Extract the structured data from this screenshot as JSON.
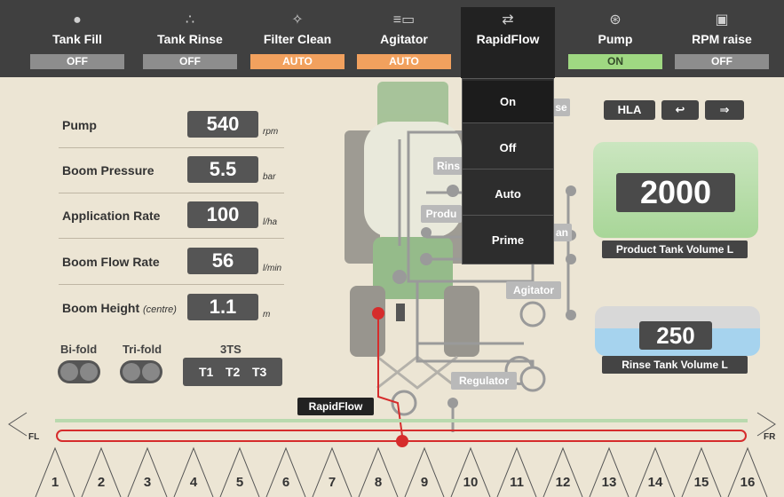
{
  "toolbar": {
    "items": [
      {
        "label": "Tank Fill",
        "status": "OFF",
        "icon": "tank-fill-icon"
      },
      {
        "label": "Tank Rinse",
        "status": "OFF",
        "icon": "tank-rinse-icon"
      },
      {
        "label": "Filter Clean",
        "status": "AUTO",
        "icon": "filter-clean-icon"
      },
      {
        "label": "Agitator",
        "status": "AUTO",
        "icon": "agitator-icon"
      },
      {
        "label": "RapidFlow",
        "status": "",
        "icon": "rapidflow-icon"
      },
      {
        "label": "Pump",
        "status": "ON",
        "icon": "pump-icon"
      },
      {
        "label": "RPM raise",
        "status": "OFF",
        "icon": "engine-icon"
      }
    ]
  },
  "dropdown": {
    "options": [
      "On",
      "Off",
      "Auto",
      "Prime"
    ]
  },
  "readings": [
    {
      "label": "Pump",
      "value": "540",
      "unit": "rpm"
    },
    {
      "label": "Boom Pressure",
      "value": "5.5",
      "unit": "bar"
    },
    {
      "label": "Application Rate",
      "value": "100",
      "unit": "l/ha"
    },
    {
      "label": "Boom Flow Rate",
      "value": "56",
      "unit": "l/min"
    },
    {
      "label": "Boom Height",
      "label_note": "(centre)",
      "value": "1.1",
      "unit": "m"
    }
  ],
  "fold": {
    "bifold": "Bi-fold",
    "trifold": "Tri-fold",
    "tts": "3TS",
    "t1": "T1",
    "t2": "T2",
    "t3": "T3"
  },
  "right": {
    "hla": "HLA",
    "product_tank": {
      "value": "2000",
      "label": "Product Tank Volume L"
    },
    "rinse_tank": {
      "value": "250",
      "label": "Rinse Tank Volume L"
    }
  },
  "diagram": {
    "rinse": "Rins",
    "product": "Produ",
    "se": "se",
    "an": "an",
    "agitator": "Agitator",
    "regulator": "Regulator",
    "rapidflow": "RapidFlow",
    "fl": "FL",
    "fr": "FR"
  },
  "nozzles": [
    "1",
    "2",
    "3",
    "4",
    "5",
    "6",
    "7",
    "8",
    "9",
    "10",
    "11",
    "12",
    "13",
    "14",
    "15",
    "16"
  ]
}
